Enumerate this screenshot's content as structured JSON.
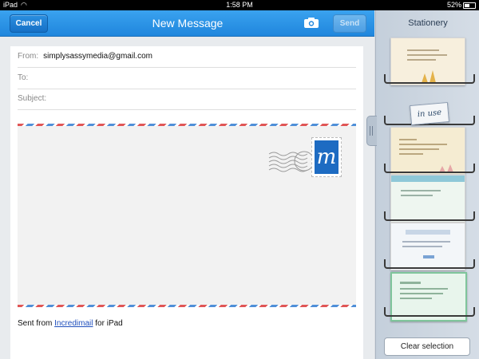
{
  "status_bar": {
    "device": "iPad",
    "time": "1:58 PM",
    "battery": "52%"
  },
  "compose": {
    "cancel_label": "Cancel",
    "title": "New Message",
    "send_label": "Send",
    "from_label": "From:",
    "from_value": "simplysassymedia@gmail.com",
    "to_label": "To:",
    "subject_label": "Subject:",
    "signature_prefix": "Sent from",
    "signature_link": "Incredimail",
    "signature_suffix": "for iPad",
    "stamp_letter": "m"
  },
  "stationery": {
    "title": "Stationery",
    "in_use_label": "in use",
    "clear_label": "Clear selection",
    "card_colors": [
      "#f7efdd",
      "#f5ecd2",
      "#eef6f0",
      "#f3f6f9",
      "#e8f5ec"
    ]
  },
  "colors": {
    "accent": "#1f86dd",
    "link": "#1f4fbd"
  }
}
